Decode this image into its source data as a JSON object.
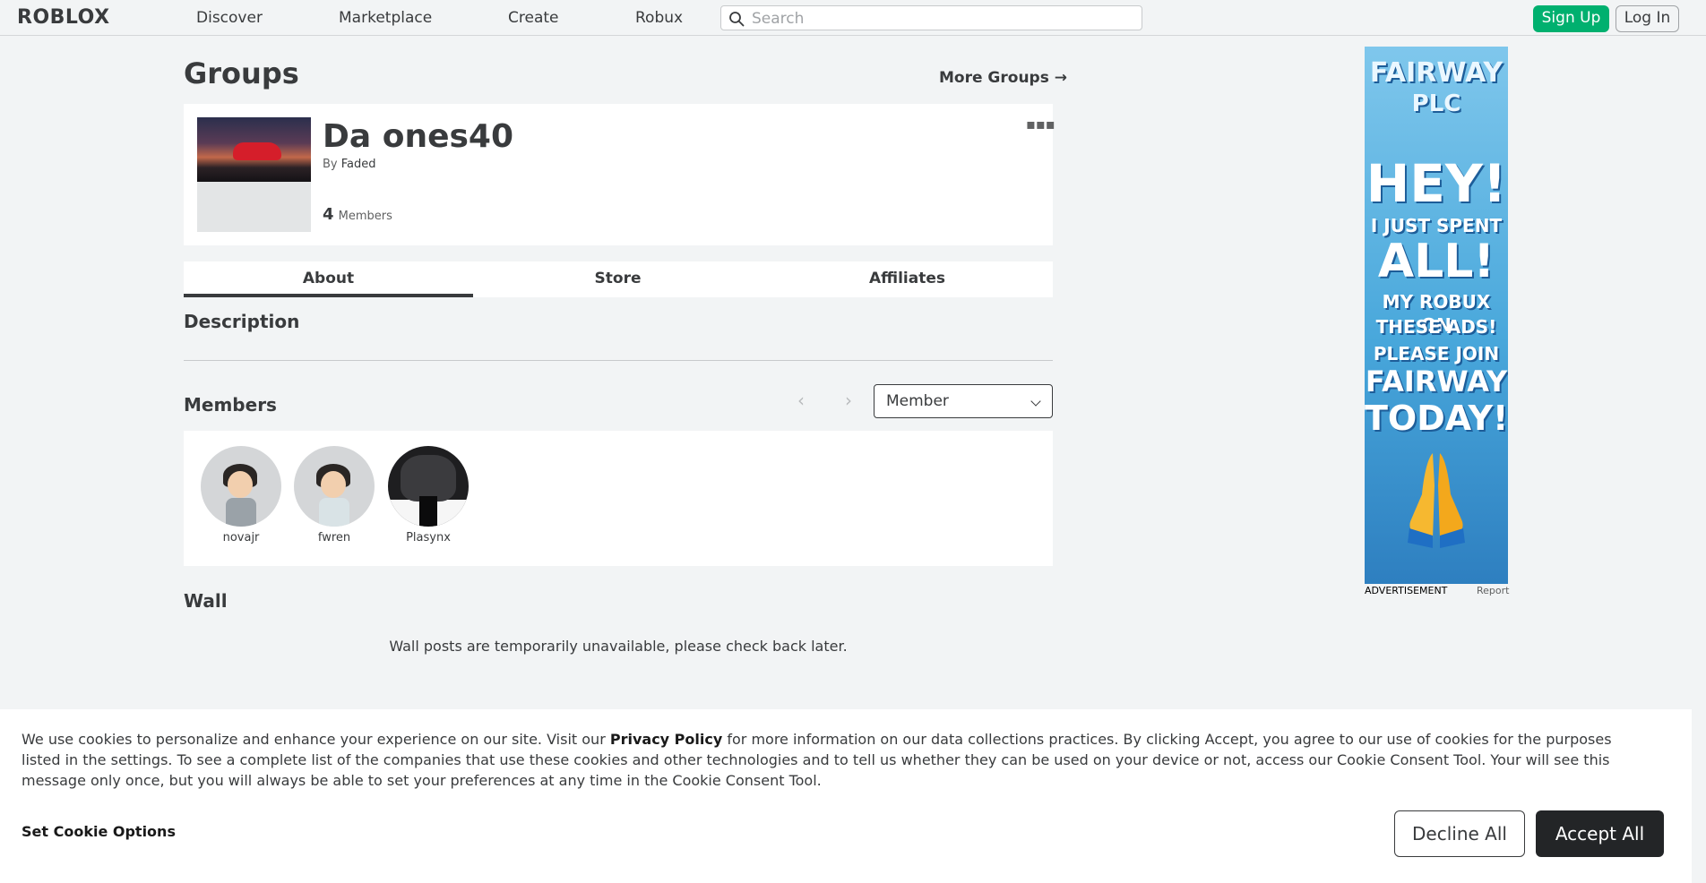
{
  "header": {
    "logo_text": "ROBLOX",
    "nav": [
      "Discover",
      "Marketplace",
      "Create",
      "Robux"
    ],
    "search_placeholder": "Search",
    "signup_label": "Sign Up",
    "login_label": "Log In"
  },
  "page": {
    "title": "Groups",
    "more_groups_label": "More Groups →"
  },
  "group": {
    "name": "Da ones40",
    "by_prefix": "By",
    "owner": "Faded",
    "member_count": "4",
    "member_label": "Members",
    "menu_glyph": "▪▪▪"
  },
  "tabs": [
    "About",
    "Store",
    "Affiliates"
  ],
  "active_tab": "About",
  "sections": {
    "description": "Description",
    "members": "Members",
    "wall": "Wall"
  },
  "members": {
    "prev_glyph": "‹",
    "next_glyph": "›",
    "role_selected": "Member",
    "list": [
      {
        "name": "novajr"
      },
      {
        "name": "fwren"
      },
      {
        "name": "Plasynx"
      }
    ]
  },
  "wall": {
    "message": "Wall posts are temporarily unavailable, please check back later."
  },
  "ad": {
    "lines": [
      "FAIRWAY",
      "PLC",
      "HEY!",
      "I JUST SPENT",
      "ALL!",
      "MY ROBUX ON",
      "THESE ADS!",
      "PLEASE JOIN",
      "FAIRWAY",
      "TODAY!"
    ],
    "label": "ADVERTISEMENT",
    "report": "Report"
  },
  "cookie": {
    "text_before": "We use cookies to personalize and enhance your experience on our site. Visit our ",
    "privacy_link": "Privacy Policy",
    "text_after": " for more information on our data collections practices. By clicking Accept, you agree to our use of cookies for the purposes listed in the settings. To see a complete list of the companies that use these cookies and other technologies and to tell us whether they can be used on your device or not, access our Cookie Consent Tool. Your will see this message only once, but you will always be able to set your preferences at any time in the Cookie Consent Tool.",
    "set_options": "Set Cookie Options",
    "decline": "Decline All",
    "accept": "Accept All"
  },
  "colors": {
    "signup_green": "#00b06f",
    "accept_dark": "#232527",
    "background": "#f2f4f5"
  }
}
